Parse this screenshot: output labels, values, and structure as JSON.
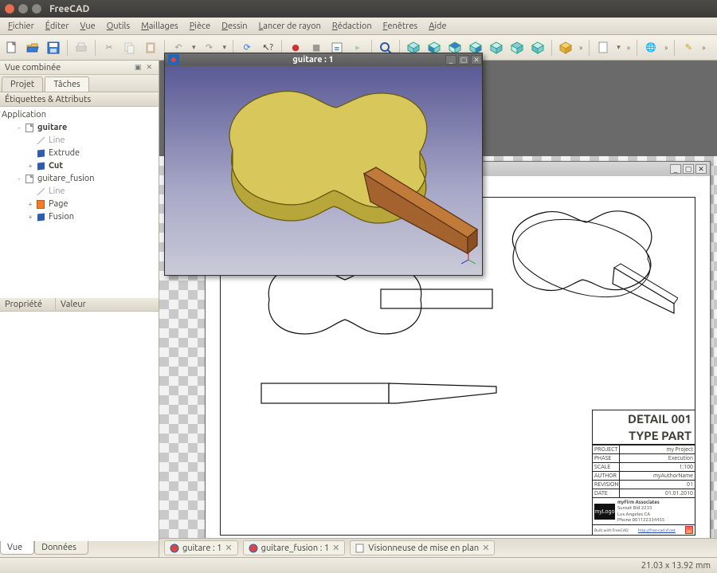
{
  "window": {
    "title": "FreeCAD"
  },
  "menu": [
    "Fichier",
    "Éditer",
    "Vue",
    "Outils",
    "Maillages",
    "Pièce",
    "Dessin",
    "Lancer de rayon",
    "Rédaction",
    "Fenêtres",
    "Aide"
  ],
  "combiview": {
    "title": "Vue combinée",
    "tabs": {
      "project": "Projet",
      "tasks": "Tâches",
      "active": "tasks"
    },
    "section": "Étiquettes & Attributs",
    "prop_headers": {
      "property": "Propriété",
      "value": "Valeur"
    },
    "bottom_tabs": {
      "view": "Vue",
      "data": "Données"
    }
  },
  "tree": {
    "root": "Application",
    "items": [
      {
        "depth": 1,
        "toggle": "-",
        "icon": "doc",
        "label": "guitare",
        "bold": true
      },
      {
        "depth": 2,
        "toggle": "",
        "icon": "line",
        "label": "Line",
        "dim": true
      },
      {
        "depth": 2,
        "toggle": "",
        "icon": "cube",
        "label": "Extrude"
      },
      {
        "depth": 2,
        "toggle": "+",
        "icon": "cube",
        "label": "Cut",
        "bold": true
      },
      {
        "depth": 1,
        "toggle": "-",
        "icon": "doc",
        "label": "guitare_fusion"
      },
      {
        "depth": 2,
        "toggle": "",
        "icon": "line",
        "label": "Line",
        "dim": true
      },
      {
        "depth": 2,
        "toggle": "+",
        "icon": "pageO",
        "label": "Page"
      },
      {
        "depth": 2,
        "toggle": "+",
        "icon": "cube",
        "label": "Fusion"
      }
    ]
  },
  "drawing": {
    "title": "Visionneuse de mise en plan",
    "titleblock": {
      "heading1": "DETAIL 001",
      "heading2": "TYPE PART",
      "rows": [
        {
          "k": "Project",
          "v": "my Project"
        },
        {
          "k": "Phase",
          "v": "Execution"
        },
        {
          "k": "Scale",
          "v": "1:100"
        },
        {
          "k": "Author",
          "v": "myAuthorName"
        },
        {
          "k": "Revision",
          "v": "01"
        },
        {
          "k": "Date",
          "v": "01.01.2010"
        }
      ],
      "firm": {
        "logo": "myLogo",
        "name": "myFirm Associates",
        "line1": "Sunset Bld 2233",
        "line2": "Los Angeles CA",
        "line3": "Phone 001122334455"
      },
      "footer": {
        "left": "Built with FreeCAD",
        "right": "http://free-cad.sf.net"
      }
    }
  },
  "view3d": {
    "title": "guitare : 1"
  },
  "doctabs": [
    {
      "label": "guitare : 1",
      "icon": "gear"
    },
    {
      "label": "guitare_fusion : 1",
      "icon": "gear"
    },
    {
      "label": "Visionneuse de mise en plan",
      "icon": "page"
    }
  ],
  "status": {
    "coords": "21.03 x 13.92 mm"
  }
}
